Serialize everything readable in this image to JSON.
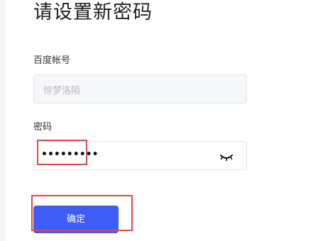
{
  "page": {
    "title": "请设置新密码"
  },
  "form": {
    "account": {
      "label": "百度帐号",
      "value": "惊梦洛陌"
    },
    "password": {
      "label": "密码",
      "value": "•••••••••",
      "toggle_icon": "eye-closed-icon"
    },
    "confirm_label": "确定"
  },
  "colors": {
    "primary": "#3f5df5",
    "highlight": "#d94a4f"
  }
}
